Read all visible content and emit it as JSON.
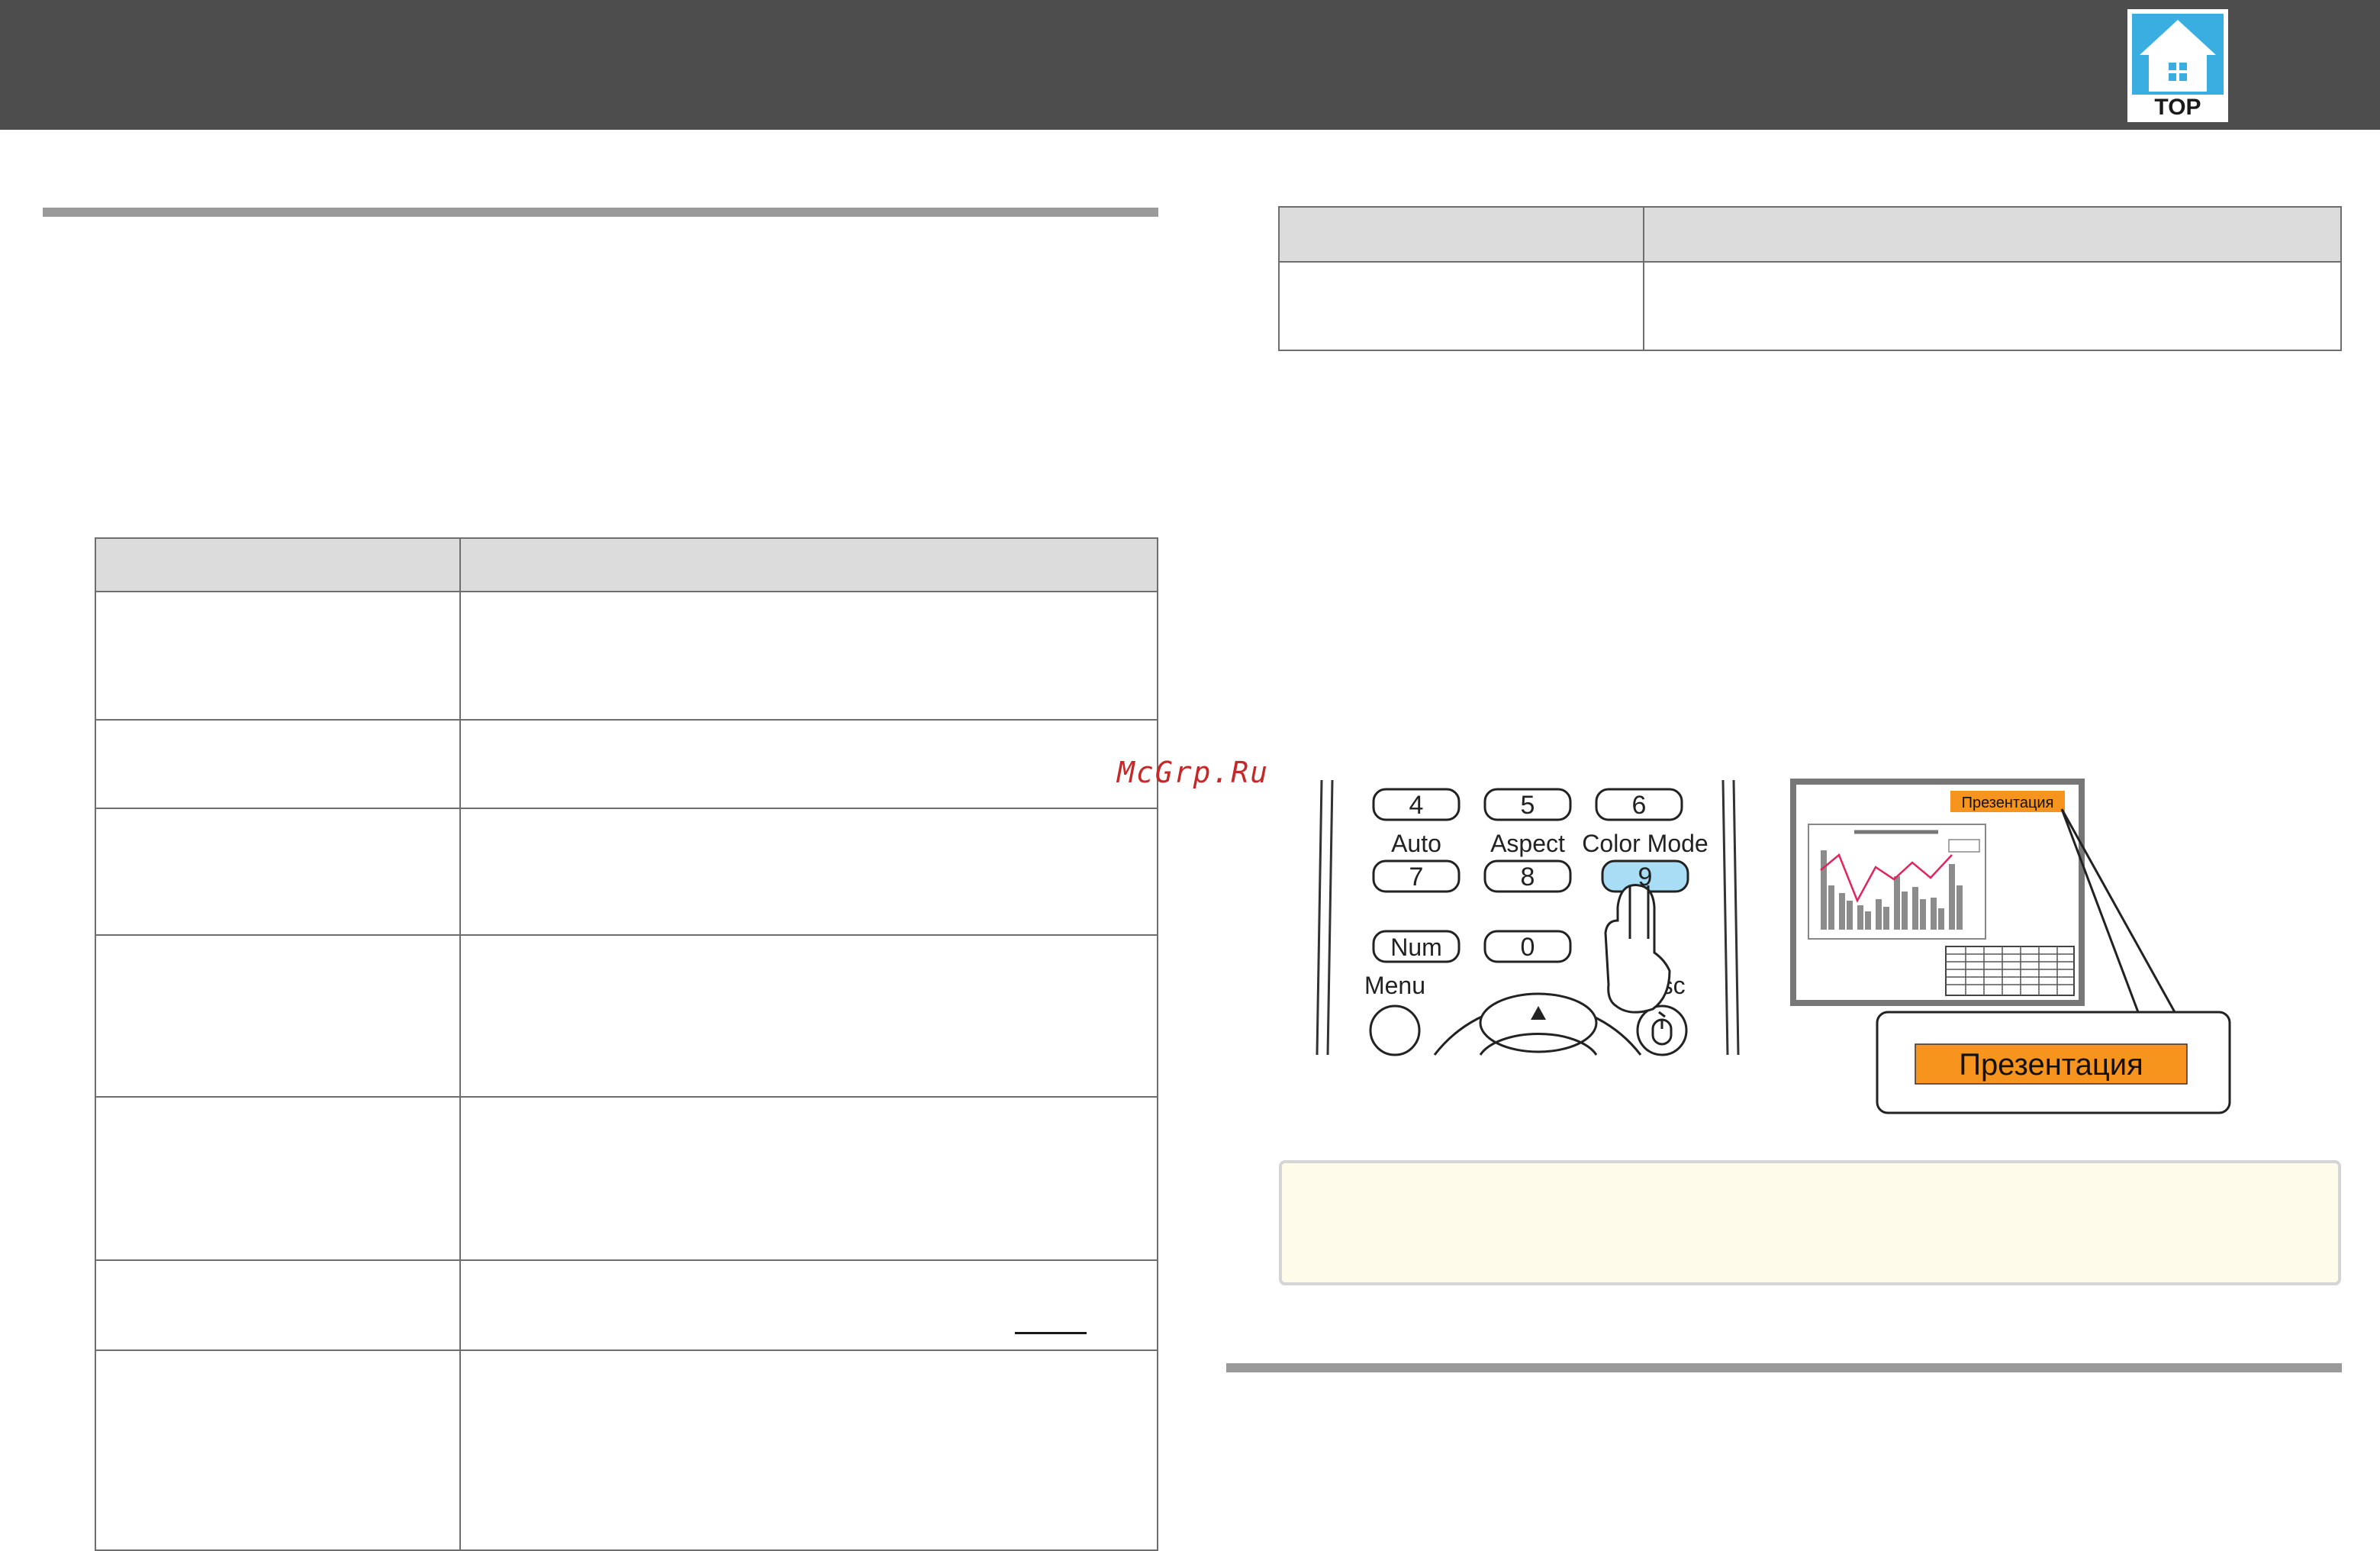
{
  "header": {
    "logo_text": "TOP",
    "bar_color": "#4d4d4d",
    "logo_color": "#3aaee0"
  },
  "watermark": {
    "text": "McGrp.Ru",
    "color": "#c62828"
  },
  "remote": {
    "row1": [
      "4",
      "5",
      "6"
    ],
    "row2_labels": [
      "Auto",
      "Aspect",
      "Color Mode"
    ],
    "row2_keys": [
      "7",
      "8",
      "9"
    ],
    "num_key": "Num",
    "zero_key": "0",
    "menu_label": "Menu",
    "esc_label": "Esc",
    "highlight_color": "#a8ddf5"
  },
  "screen": {
    "mode_badge": "Презентация",
    "callout_label": "Презентация",
    "badge_color": "#f7941d"
  },
  "colors": {
    "table_header": "#dcdcdc",
    "note_background": "#fffbea",
    "rule": "#9a9a9a"
  }
}
